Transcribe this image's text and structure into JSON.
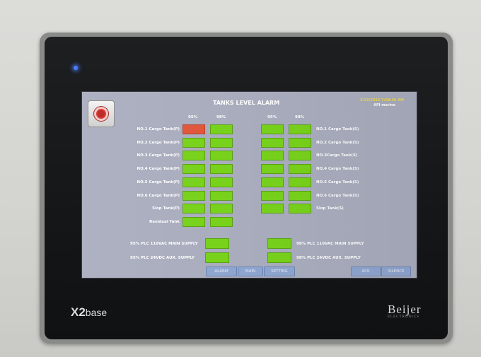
{
  "hardware": {
    "brand_left_model": "X2",
    "brand_left_suffix": "base",
    "brand_right": "Beijer",
    "brand_right_sub": "ELECTRONICS"
  },
  "header": {
    "title": "TANKS LEVEL ALARM",
    "date": "5/22/2023 7:58:46 AM",
    "ship": "API marine",
    "col_95": "95%",
    "col_98": "98%"
  },
  "tanks_left": [
    {
      "label": "NO.1 Cargo Tank(P)",
      "s95": "alarm",
      "s98": "ok"
    },
    {
      "label": "NO.2 Cargo Tank(P)",
      "s95": "ok",
      "s98": "ok"
    },
    {
      "label": "NO.3 Cargo Tank(P)",
      "s95": "ok",
      "s98": "ok"
    },
    {
      "label": "NO.4 Cargo Tank(P)",
      "s95": "ok",
      "s98": "ok"
    },
    {
      "label": "NO.5 Cargo Tank(P)",
      "s95": "ok",
      "s98": "ok"
    },
    {
      "label": "NO.6 Cargo Tank(P)",
      "s95": "ok",
      "s98": "ok"
    },
    {
      "label": "Slop Tank(P)",
      "s95": "ok",
      "s98": "ok"
    },
    {
      "label": "Residual Tank",
      "s95": "ok",
      "s98": "ok"
    }
  ],
  "tanks_right": [
    {
      "label": "NO.1 Cargo Tank(S)",
      "s95": "ok",
      "s98": "ok"
    },
    {
      "label": "NO.2 Cargo Tank(S)",
      "s95": "ok",
      "s98": "ok"
    },
    {
      "label": "NO.3Cargo Tank(S)",
      "s95": "ok",
      "s98": "ok"
    },
    {
      "label": "NO.4 Cargo Tank(S)",
      "s95": "ok",
      "s98": "ok"
    },
    {
      "label": "NO.5 Cargo Tank(S)",
      "s95": "ok",
      "s98": "ok"
    },
    {
      "label": "NO.6 Cargo Tank(S)",
      "s95": "ok",
      "s98": "ok"
    },
    {
      "label": "Slop Tank(S)",
      "s95": "ok",
      "s98": "ok"
    }
  ],
  "supply": {
    "left_main": "95% PLC 110VAC MAIN SUPPLY",
    "left_aux": "95% PLC 24VDC AUX. SUPPLY",
    "right_main": "98% PLC 110VAC MAIN SUPPLY",
    "right_aux": "98% PLC 24VDC AUX. SUPPLY"
  },
  "nav": {
    "alarm": "ALARM",
    "main": "MAIN",
    "setting": "SETTING",
    "ack": "ACK",
    "silence": "SILENCE"
  },
  "colors": {
    "ok": "#78d21b",
    "alarm": "#e0563b",
    "screen_bg": "#a9adbe",
    "date": "#f0d94a"
  }
}
